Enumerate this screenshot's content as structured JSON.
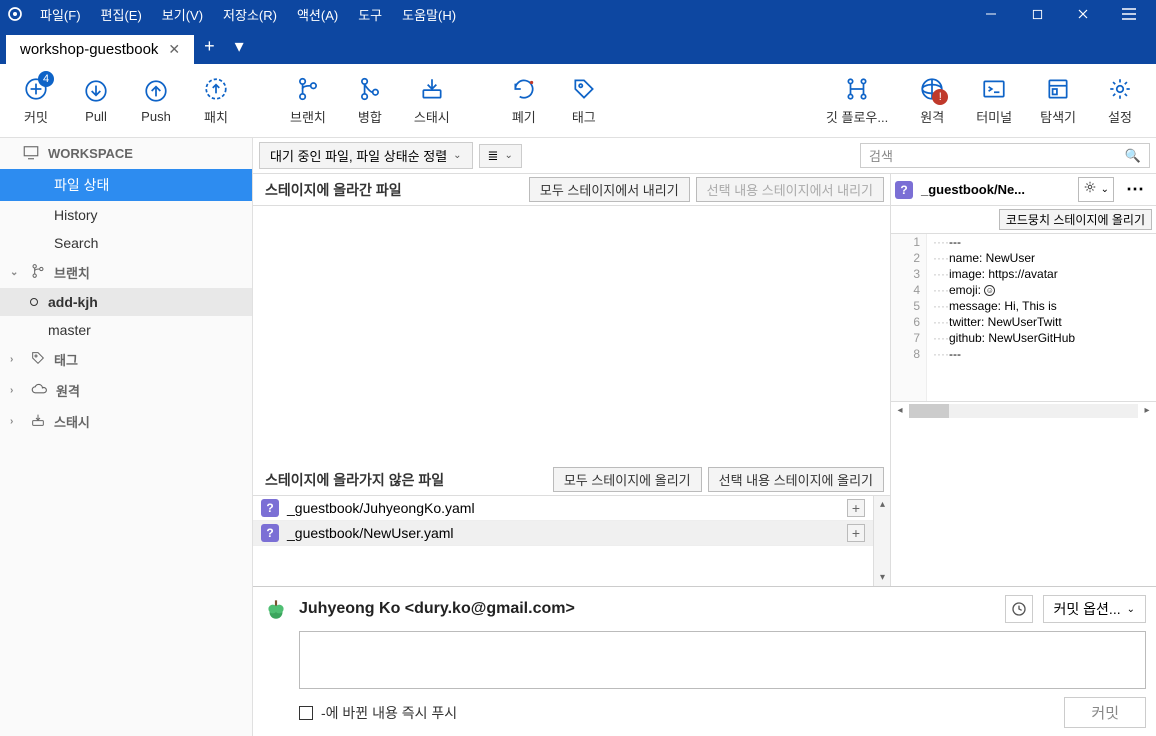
{
  "menus": {
    "file": "파일(F)",
    "edit": "편집(E)",
    "view": "보기(V)",
    "repo": "저장소(R)",
    "action": "액션(A)",
    "tools": "도구",
    "help": "도움말(H)"
  },
  "tab": {
    "name": "workshop-guestbook"
  },
  "tools": {
    "commit": "커밋",
    "pull": "Pull",
    "push": "Push",
    "patch": "패치",
    "branch": "브랜치",
    "merge": "병합",
    "stash": "스태시",
    "discard": "폐기",
    "tag": "태그",
    "gitflow": "깃 플로우...",
    "remote": "원격",
    "terminal": "터미널",
    "explorer": "탐색기",
    "settings": "설정",
    "commit_badge": "4"
  },
  "sidebar": {
    "workspace": "WORKSPACE",
    "ws": {
      "status": "파일 상태",
      "history": "History",
      "search": "Search"
    },
    "branch": "브랜치",
    "branches": {
      "b1": "add-kjh",
      "b2": "master"
    },
    "tag": "태그",
    "remote": "원격",
    "stash": "스태시"
  },
  "center": {
    "pending_sort": "대기 중인 파일, 파일 상태순 정렬",
    "search_ph": "검색",
    "staged_title": "스테이지에 올라간 파일",
    "unstage_all": "모두 스테이지에서 내리기",
    "unstage_sel": "선택 내용 스테이지에서 내리기",
    "unstaged_title": "스테이지에 올라가지 않은 파일",
    "stage_all": "모두 스테이지에 올리기",
    "stage_sel": "선택 내용 스테이지에 올리기",
    "files": {
      "f1": "_guestbook/JuhyeongKo.yaml",
      "f2": "_guestbook/NewUser.yaml"
    }
  },
  "diff": {
    "filename": "_guestbook/Ne...",
    "stage_hunk": "코드뭉치 스테이지에 올리기",
    "lines": {
      "l1": "---",
      "l2": "name: NewUser",
      "l3": "image: https://avatar",
      "l4": "emoji: ",
      "l5": "message: Hi, This is ",
      "l6": "twitter: NewUserTwitt",
      "l7": "github: NewUserGitHub",
      "l8": "---"
    }
  },
  "commit": {
    "author": "Juhyeong Ko <dury.ko@gmail.com>",
    "options": "커밋 옵션...",
    "push_label": "-에 바뀐 내용 즉시 푸시",
    "btn": "커밋"
  }
}
